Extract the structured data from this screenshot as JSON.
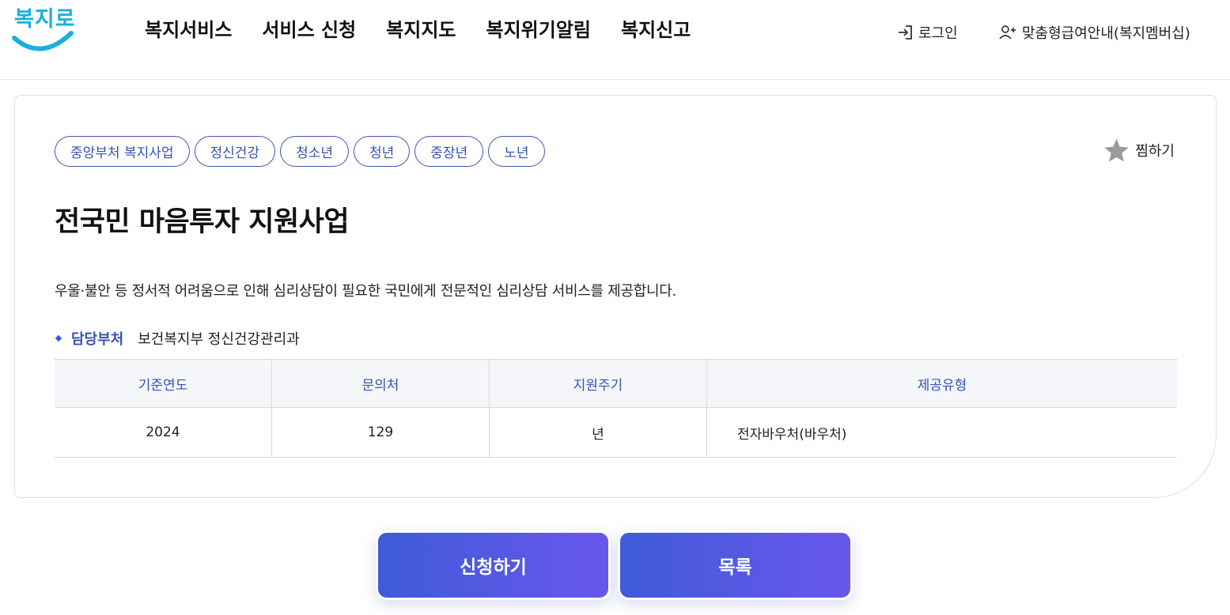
{
  "header": {
    "logo_text": "복지로",
    "nav": [
      "복지서비스",
      "서비스 신청",
      "복지지도",
      "복지위기알림",
      "복지신고"
    ],
    "login_label": "로그인",
    "member_label": "맞춤형급여안내(복지멤버십)"
  },
  "service": {
    "tags": [
      "중앙부처 복지사업",
      "정신건강",
      "청소년",
      "청년",
      "중장년",
      "노년"
    ],
    "favorite_label": "찜하기",
    "title": "전국민 마음투자 지원사업",
    "description": "우울·불안 등 정서적 어려움으로 인해 심리상담이 필요한 국민에게 전문적인 심리상담 서비스를 제공합니다.",
    "department_label": "담당부처",
    "department_value": "보건복지부 정신건강관리과",
    "table": {
      "headers": [
        "기준연도",
        "문의처",
        "지원주기",
        "제공유형"
      ],
      "row": [
        "2024",
        "129",
        "년",
        "전자바우처(바우처)"
      ]
    }
  },
  "actions": {
    "apply_label": "신청하기",
    "list_label": "목록"
  },
  "colors": {
    "accent": "#3652b3",
    "logo": "#1ab0dc",
    "button_gradient_start": "#3e5bd8",
    "button_gradient_end": "#6a57ec",
    "star": "#9a9a9a"
  },
  "icons": {
    "login": "login-arrow-icon",
    "member": "user-plus-icon",
    "favorite": "star-icon"
  }
}
